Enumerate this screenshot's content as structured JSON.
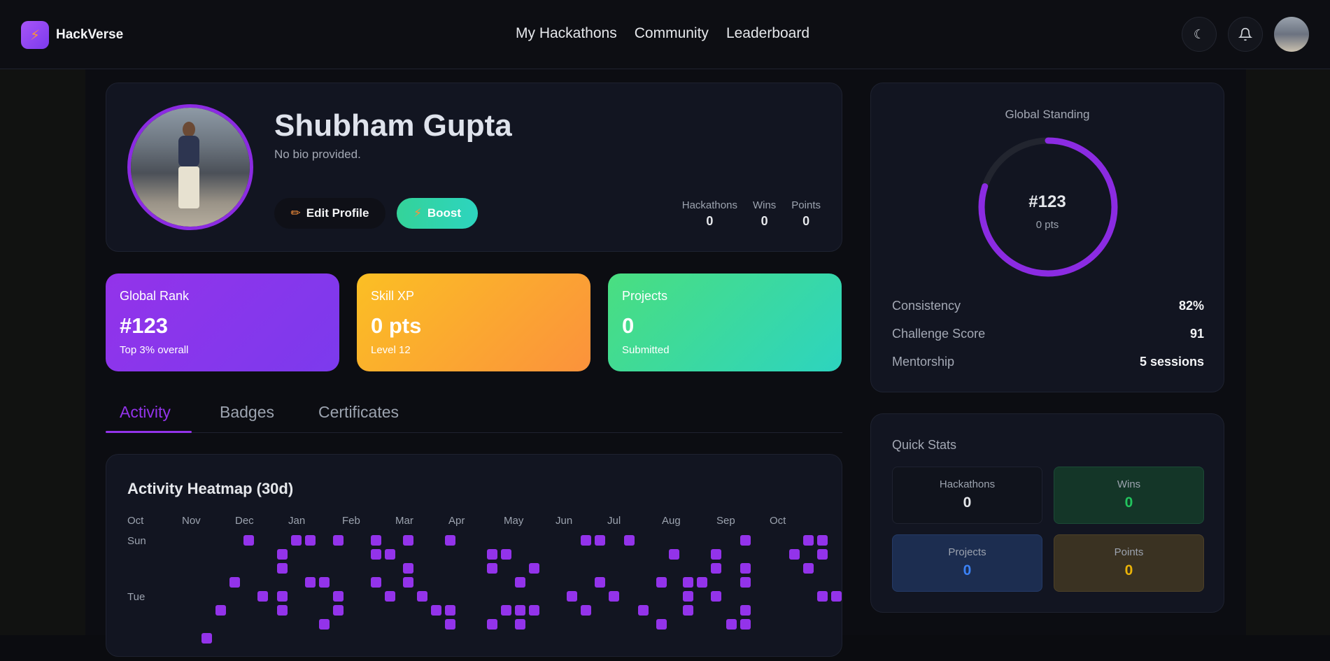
{
  "app": {
    "name": "HackVerse",
    "logo_glyph": "⚡"
  },
  "nav": {
    "items": [
      "My Hackathons",
      "Community",
      "Leaderboard"
    ]
  },
  "top_actions": {
    "theme_icon": "☾",
    "bell_icon": "🔔"
  },
  "profile": {
    "name": "Shubham Gupta",
    "bio": "No bio provided.",
    "edit_label": "Edit Profile",
    "boost_label": "Boost",
    "edit_icon": "✏",
    "boost_icon": "⚡",
    "stats": [
      {
        "label": "Hackathons",
        "value": "0"
      },
      {
        "label": "Wins",
        "value": "0"
      },
      {
        "label": "Points",
        "value": "0"
      }
    ]
  },
  "cards": {
    "rank": {
      "title": "Global Rank",
      "value": "#123",
      "sub": "Top 3% overall"
    },
    "xp": {
      "title": "Skill XP",
      "value": "0 pts",
      "sub": "Level 12"
    },
    "projects": {
      "title": "Projects",
      "value": "0",
      "sub": "Submitted"
    }
  },
  "tabs": [
    "Activity",
    "Badges",
    "Certificates"
  ],
  "heatmap": {
    "title": "Activity Heatmap (30d)",
    "months": [
      "Oct",
      "Nov",
      "Dec",
      "Jan",
      "Feb",
      "Mar",
      "Apr",
      "May",
      "Jun",
      "Jul",
      "Aug",
      "Sep",
      "Oct"
    ],
    "day_labels": [
      "Sun",
      "Tue"
    ]
  },
  "standing": {
    "title": "Global Standing",
    "rank": "#123",
    "points": "0 pts",
    "progress_fraction": 0.8,
    "metrics": [
      {
        "label": "Consistency",
        "value": "82%"
      },
      {
        "label": "Challenge Score",
        "value": "91"
      },
      {
        "label": "Mentorship",
        "value": "5 sessions"
      }
    ]
  },
  "quick_stats": {
    "title": "Quick Stats",
    "hackathons": {
      "label": "Hackathons",
      "value": "0",
      "color": "#e5e7eb"
    },
    "wins": {
      "label": "Wins",
      "value": "0",
      "color": "#22c55e"
    },
    "projects": {
      "label": "Projects",
      "value": "0",
      "color": "#3b82f6"
    },
    "points": {
      "label": "Points",
      "value": "0",
      "color": "#eab308"
    }
  },
  "colors": {
    "accent": "#9333ea"
  }
}
